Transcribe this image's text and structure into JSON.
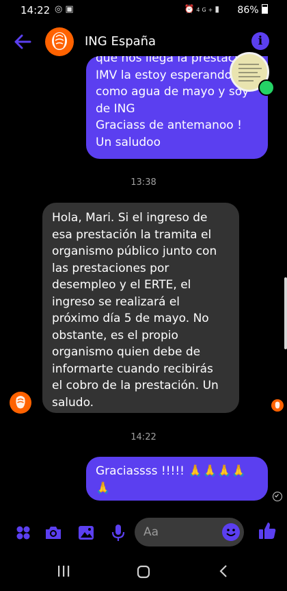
{
  "status_bar": {
    "time": "14:22",
    "battery": "86%",
    "left_icons": [
      "whatsapp-icon",
      "notification-icon"
    ],
    "right_icons": [
      "alarm-icon",
      "4g-icon",
      "signal-icon",
      "battery-icon"
    ]
  },
  "header": {
    "title": "ING España",
    "back_icon": "back-arrow-icon",
    "info_icon": "info-icon"
  },
  "messages": [
    {
      "direction": "outgoing",
      "lines": [
        "que nos llega la prestación",
        "IMV la estoy esperando",
        "como agua de mayo y soy",
        "de ING",
        "Graciass de antemanoo !",
        "Un saludoo"
      ]
    },
    {
      "timestamp": "13:38"
    },
    {
      "direction": "incoming",
      "lines": [
        "Hola, Mari. Si el ingreso de",
        "esa prestación la tramita el",
        "organismo público junto con",
        "las prestaciones por",
        "desempleo y el ERTE, el",
        "ingreso se realizará el",
        "próximo día 5 de mayo. No",
        "obstante, es el propio",
        "organismo quien debe de",
        "informarte cuando recibirás",
        "el cobro de la prestación. Un",
        "saludo."
      ]
    },
    {
      "timestamp": "14:22"
    },
    {
      "direction": "outgoing",
      "lines": [
        "Graciassss !!!!! 🙏🙏🙏🙏",
        "🙏"
      ]
    }
  ],
  "composer": {
    "placeholder": "Aa",
    "icons": [
      "apps-icon",
      "camera-icon",
      "gallery-icon",
      "microphone-icon",
      "emoji-icon",
      "like-icon"
    ]
  },
  "colors": {
    "accent": "#5b3ff0",
    "background": "#000000",
    "incoming_bubble": "#333333",
    "ing_orange": "#ff6200"
  }
}
